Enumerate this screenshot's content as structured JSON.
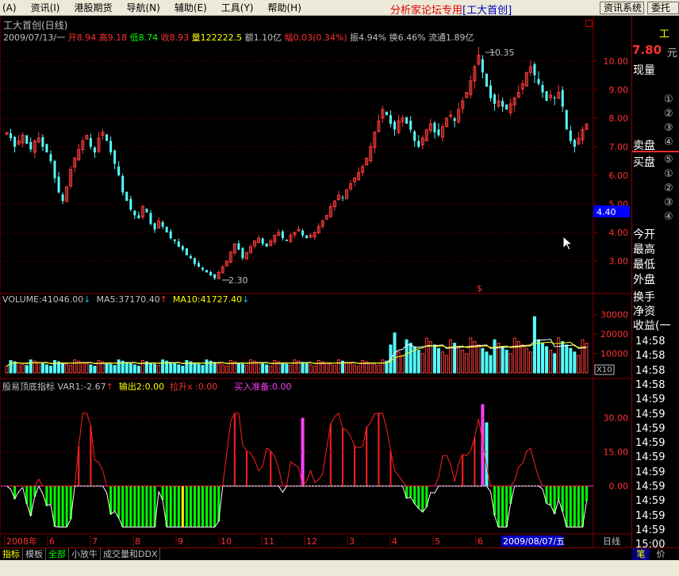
{
  "menu": {
    "items": [
      "(A)",
      "资讯(I)",
      "港股期货",
      "导航(N)",
      "辅助(E)",
      "工具(Y)",
      "帮助(H)"
    ],
    "title_prefix": "分析家论坛专用",
    "title_stock": "[工大首创]",
    "btn_info": "资讯系统",
    "btn_more": "委托"
  },
  "header": {
    "title": "工大首创(日线)",
    "date": "2009/07/13/一",
    "open_label": "开",
    "open": "8.94",
    "high_label": "高",
    "high": "9.18",
    "low_label": "低",
    "low": "8.74",
    "close_label": "收",
    "close": "8.93",
    "vol_label": "量",
    "vol": "122222.5",
    "amount_label": "额",
    "amount": "1.10亿",
    "change_label": "幅",
    "change": "0.03(0.34%)",
    "amp_label": "振",
    "amp": "4.94%",
    "turn_label": "换",
    "turn": "6.46%",
    "float_label": "流通",
    "float": "1.89亿",
    "close_icon": "square-close-icon"
  },
  "volume_header": {
    "volume": "VOLUME:41046.00",
    "ma5": "MA5:37170.40",
    "ma10": "MA10:41727.40"
  },
  "indicator_header": {
    "name": "股易顶底指标",
    "var1": "VAR1:-2.67",
    "out": "输出2:0.00",
    "rise": "拉升x :0.00",
    "buy": "买入准备:0.00"
  },
  "annotations": {
    "high_mark": "10.35",
    "low_mark": "2.30",
    "s_mark": "$",
    "x10": "X10"
  },
  "axis": {
    "price_ticks": [
      {
        "label": "10.00",
        "value": 10.0
      },
      {
        "label": "9.00",
        "value": 9.0
      },
      {
        "label": "8.00",
        "value": 8.0
      },
      {
        "label": "7.00",
        "value": 7.0
      },
      {
        "label": "6.00",
        "value": 6.0
      },
      {
        "label": "5.00",
        "value": 5.0
      },
      {
        "label": "4.00",
        "value": 4.0
      },
      {
        "label": "3.00",
        "value": 3.0
      }
    ],
    "current_price_tag": "4.40",
    "volume_ticks": [
      {
        "label": "30000",
        "value": 30000
      },
      {
        "label": "20000",
        "value": 20000
      },
      {
        "label": "10000",
        "value": 10000
      }
    ],
    "indicator_ticks": [
      {
        "label": "30.00",
        "value": 30
      },
      {
        "label": "15.00",
        "value": 15
      },
      {
        "label": "0.00",
        "value": 0
      }
    ],
    "date_labels": [
      "2008年",
      "6",
      "7",
      "8",
      "9",
      "10",
      "11",
      "12",
      "3",
      "4",
      "5",
      "6"
    ],
    "date_highlight": "2009/08/07/五",
    "period": "日线"
  },
  "right_panel": {
    "price": "7.80",
    "price_unit": "元",
    "top_mark": "工",
    "labels": [
      "现量",
      "卖盘",
      "买盘",
      "今开",
      "最高",
      "最低",
      "外盘",
      "换手",
      "净资",
      "收益(一"
    ],
    "circled": [
      "①",
      "②",
      "③",
      "④",
      "⑤",
      "①",
      "②",
      "③",
      "④",
      "⑤"
    ],
    "times": [
      "14:58",
      "14:58",
      "14:58",
      "14:58",
      "14:59",
      "14:59",
      "14:59",
      "14:59",
      "14:59",
      "14:59",
      "14:59",
      "14:59",
      "14:59",
      "14:59",
      "15:00"
    ]
  },
  "bottom_tabs": [
    "指标",
    "模板",
    "全部",
    "小放牛",
    "成交量和DDX"
  ],
  "bottom_right": [
    "笔",
    "价"
  ],
  "chart_data": {
    "type": "candlestick",
    "price_range": [
      2.0,
      10.8
    ],
    "price_high": 10.35,
    "price_low": 2.3,
    "close_series": [
      7.5,
      7.3,
      7.0,
      7.2,
      7.4,
      7.1,
      6.9,
      7.2,
      7.3,
      7.0,
      6.8,
      6.5,
      5.9,
      5.4,
      5.1,
      5.6,
      6.2,
      6.6,
      6.9,
      7.2,
      7.4,
      7.0,
      6.8,
      7.3,
      7.5,
      7.2,
      6.8,
      6.4,
      6.0,
      5.4,
      5.1,
      4.8,
      4.6,
      4.5,
      4.9,
      4.7,
      4.3,
      4.1,
      4.4,
      4.2,
      4.0,
      3.8,
      3.7,
      3.5,
      3.4,
      3.2,
      3.1,
      2.9,
      2.8,
      2.7,
      2.6,
      2.5,
      2.4,
      2.6,
      2.8,
      3.0,
      3.3,
      3.6,
      3.4,
      3.1,
      3.3,
      3.5,
      3.7,
      3.8,
      3.6,
      3.5,
      3.7,
      3.9,
      4.0,
      3.8,
      3.7,
      3.9,
      4.0,
      4.1,
      3.9,
      3.8,
      3.9,
      4.0,
      4.2,
      4.4,
      4.6,
      4.9,
      5.1,
      5.3,
      5.2,
      5.5,
      5.7,
      5.9,
      6.1,
      6.3,
      6.6,
      7.0,
      7.5,
      7.9,
      8.3,
      8.1,
      7.8,
      7.6,
      7.9,
      8.0,
      7.8,
      7.6,
      7.2,
      7.0,
      7.3,
      7.6,
      7.8,
      7.5,
      7.4,
      7.7,
      8.0,
      8.1,
      7.9,
      8.3,
      8.6,
      8.9,
      9.3,
      9.8,
      10.2,
      9.6,
      9.1,
      8.7,
      8.5,
      8.6,
      8.4,
      8.3,
      8.5,
      8.7,
      8.9,
      9.2,
      9.6,
      9.8,
      9.5,
      9.2,
      8.9,
      8.6,
      8.8,
      8.7,
      8.9,
      8.4,
      7.6,
      7.2,
      7.0,
      7.3,
      7.6,
      7.8
    ],
    "volume_range": [
      0,
      36000
    ],
    "indicator_range": [
      -20,
      40
    ]
  }
}
